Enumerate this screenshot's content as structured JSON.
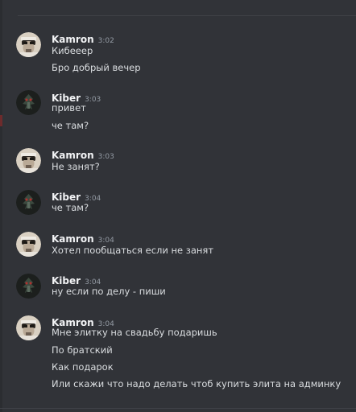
{
  "groups": [
    {
      "author": "Kamron",
      "time": "3:02",
      "avatar": "kamron-avatar",
      "messages": [
        "Кибееер",
        "Бро добрый вечер"
      ]
    },
    {
      "author": "Kiber",
      "time": "3:03",
      "avatar": "kiber-avatar",
      "messages": [
        "привет",
        "че там?"
      ]
    },
    {
      "author": "Kamron",
      "time": "3:03",
      "avatar": "kamron-avatar",
      "messages": [
        "Не занят?"
      ]
    },
    {
      "author": "Kiber",
      "time": "3:04",
      "avatar": "kiber-avatar",
      "messages": [
        "че там?"
      ]
    },
    {
      "author": "Kamron",
      "time": "3:04",
      "avatar": "kamron-avatar",
      "messages": [
        "Хотел пообщаться если не занят"
      ]
    },
    {
      "author": "Kiber",
      "time": "3:04",
      "avatar": "kiber-avatar",
      "messages": [
        "ну если по делу - пиши"
      ]
    },
    {
      "author": "Kamron",
      "time": "3:04",
      "avatar": "kamron-avatar",
      "messages": [
        "Мне элитку на свадьбу подаришь",
        "По братский",
        "Как подарок",
        "Или скажи что надо делать чтоб купить элита на админку"
      ]
    }
  ]
}
